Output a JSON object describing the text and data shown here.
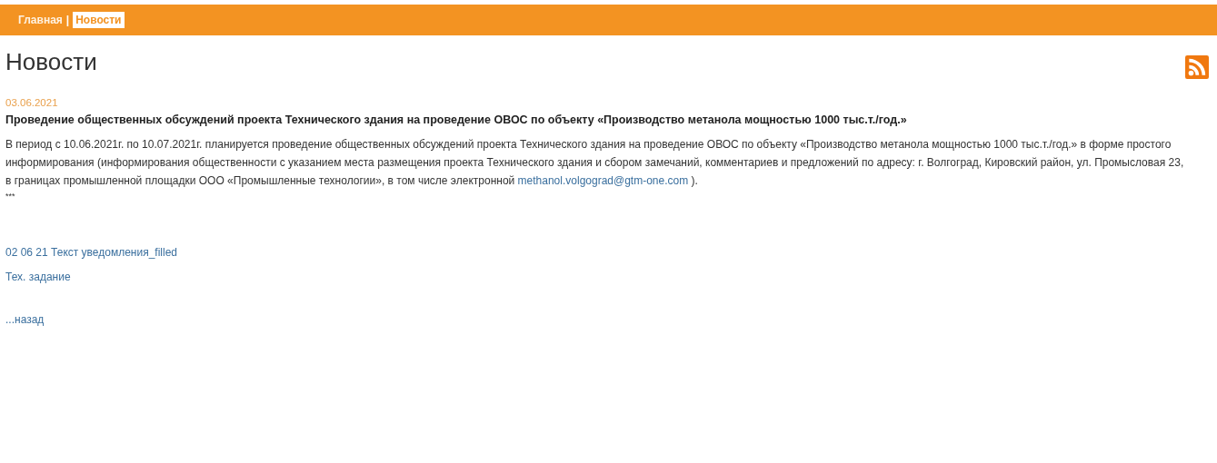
{
  "breadcrumb": [
    {
      "label": "Главная",
      "selected": false
    },
    {
      "label": "Новости",
      "selected": true
    }
  ],
  "breadcrumb_separator": "|",
  "page_title": "Новости",
  "news": {
    "date": "03.06.2021",
    "headline": "Проведение общественных обсуждений проекта Технического здания на проведение ОВОС по объекту «Производство метанола мощностью 1000 тыс.т./год.»",
    "body_before": "В период с 10.06.2021г. по 10.07.2021г. планируется проведение общественных обсуждений проекта Технического здания на проведение ОВОС по объекту «Производство метанола мощностью 1000 тыс.т./год.» в форме простого информирования (информирования общественности с указанием места размещения проекта Технического здания и сбором замечаний, комментариев и предложений по адресу: г. Волгоград, Кировский район, ул. Промысловая 23, в границах промышленной площадки ООО «Промышленные технологии», в том числе электронной ",
    "email": "methanol.volgograd@gtm-one.com",
    "body_after": " ).",
    "divider": "***",
    "attachments": [
      "02 06 21 Текст уведомления_filled",
      "Тех. задание"
    ]
  },
  "back_link": "...назад"
}
